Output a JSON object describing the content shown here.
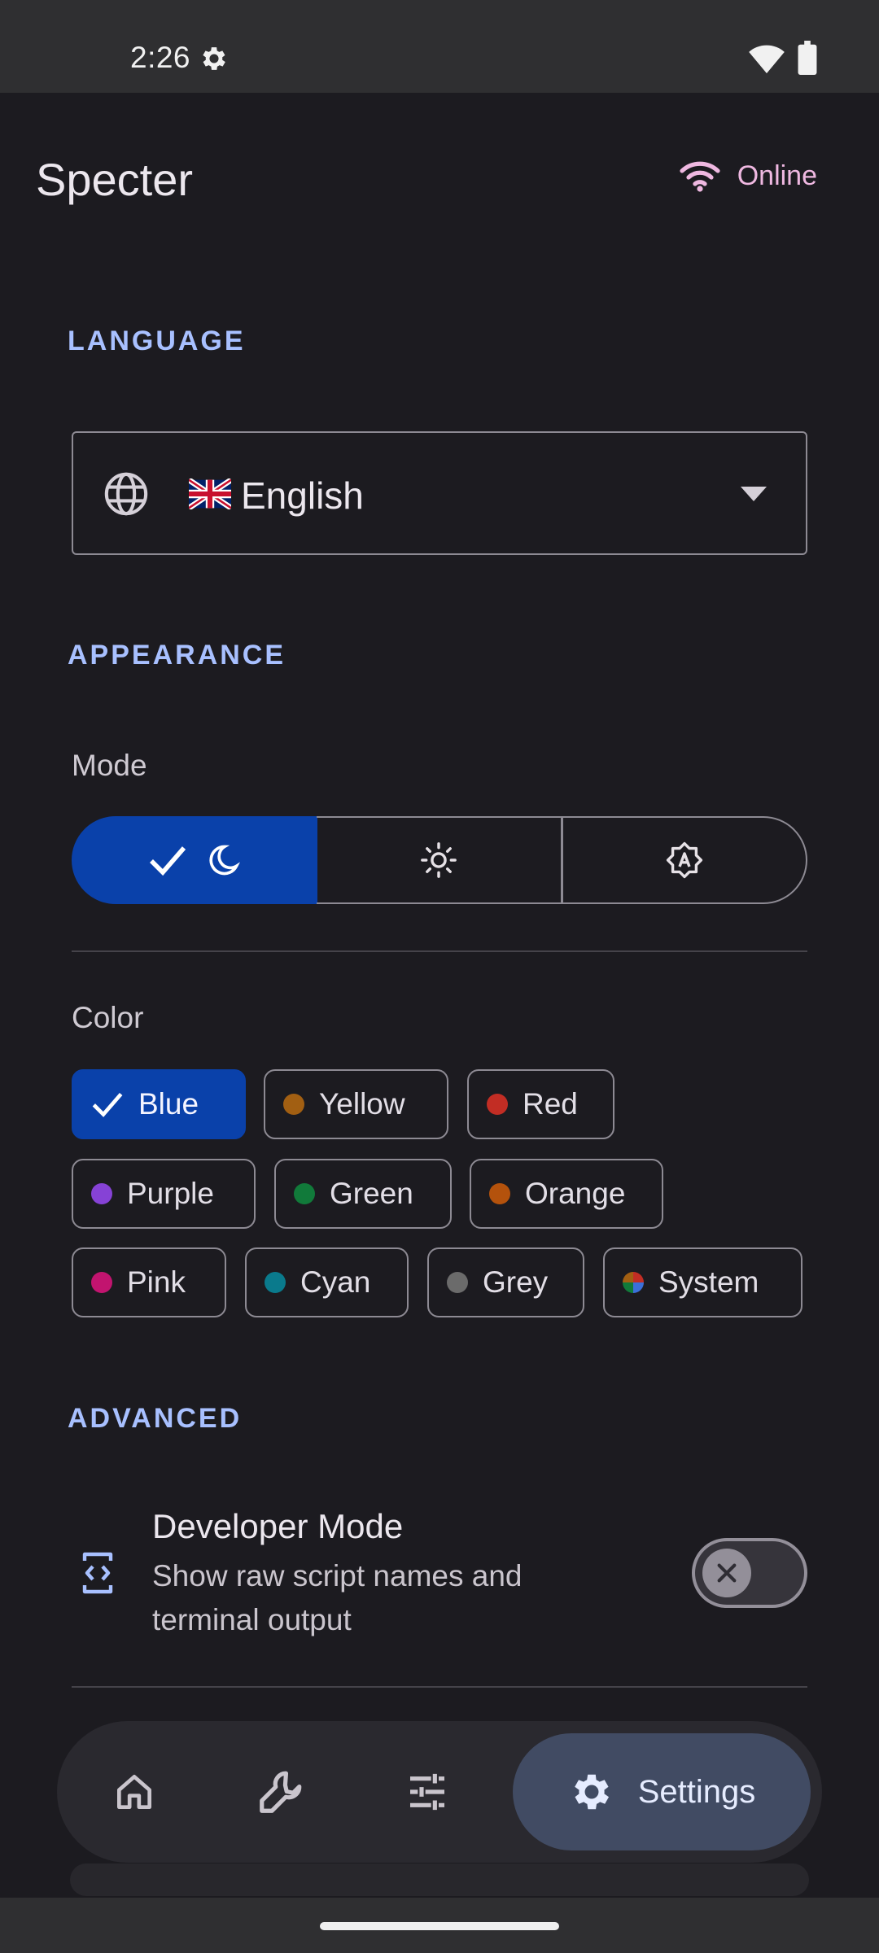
{
  "status_bar": {
    "time": "2:26"
  },
  "header": {
    "title": "Specter",
    "status": "Online"
  },
  "sections": {
    "language": "LANGUAGE",
    "appearance": "APPEARANCE",
    "advanced": "ADVANCED"
  },
  "language": {
    "selected": "English",
    "flag": "uk-flag-icon"
  },
  "appearance": {
    "mode_label": "Mode",
    "modes": [
      {
        "id": "dark",
        "icon": "moon-icon",
        "selected": true
      },
      {
        "id": "light",
        "icon": "sun-icon",
        "selected": false
      },
      {
        "id": "auto",
        "icon": "brightness-auto-icon",
        "selected": false
      }
    ],
    "color_label": "Color",
    "colors": [
      {
        "label": "Blue",
        "dot": "#0a41aa",
        "selected": true
      },
      {
        "label": "Yellow",
        "dot": "#a25f12"
      },
      {
        "label": "Red",
        "dot": "#c22d24"
      },
      {
        "label": "Purple",
        "dot": "#8642d6"
      },
      {
        "label": "Green",
        "dot": "#117a3a"
      },
      {
        "label": "Orange",
        "dot": "#b4520c"
      },
      {
        "label": "Pink",
        "dot": "#c2146f"
      },
      {
        "label": "Cyan",
        "dot": "#0a7a8c"
      },
      {
        "label": "Grey",
        "dot": "#6b6b6b"
      },
      {
        "label": "System",
        "dot": "multicolor"
      }
    ]
  },
  "advanced": {
    "developer_mode": {
      "title": "Developer Mode",
      "description": "Show raw script names and terminal output",
      "enabled": false
    }
  },
  "bottom_nav": {
    "items": [
      {
        "id": "home",
        "icon": "home-icon"
      },
      {
        "id": "tools",
        "icon": "wrench-icon"
      },
      {
        "id": "tweaks",
        "icon": "sliders-icon"
      },
      {
        "id": "settings",
        "icon": "gear-icon",
        "label": "Settings",
        "active": true
      }
    ]
  },
  "colors": {
    "accent": "#0a41aa",
    "section_label": "#a8c0ff",
    "online": "#efb8e1",
    "background": "#1c1b20"
  }
}
